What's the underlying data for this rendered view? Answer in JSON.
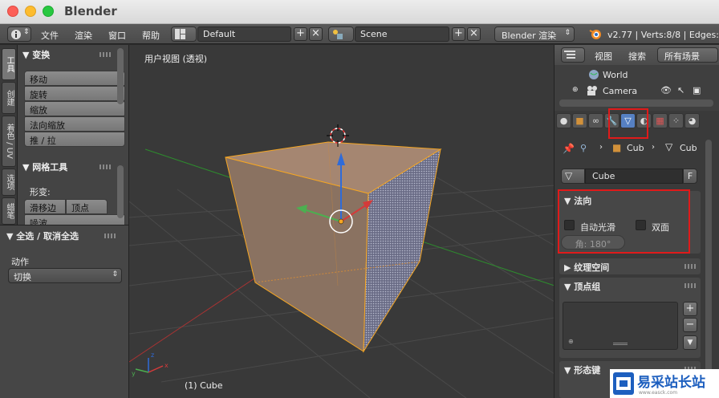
{
  "window": {
    "title": "Blender"
  },
  "header": {
    "menus": [
      "文件",
      "渲染",
      "窗口",
      "帮助"
    ],
    "screen_layout": "Default",
    "scene": "Scene",
    "render_engine": "Blender 渲染",
    "status": "v2.77 | Verts:8/8 | Edges:1"
  },
  "left_tabs": [
    "工具",
    "创建",
    "着色 / UV",
    "选项",
    "蜡笔"
  ],
  "tools": {
    "transform_header": "▼ 变换",
    "transform_buttons": [
      "移动",
      "旋转",
      "缩放",
      "法向缩放",
      "推 / 拉"
    ],
    "mesh_tools_header": "▼ 网格工具",
    "deform_label": "形变:",
    "slide_edge": "滑移边",
    "vertex": "顶点",
    "smooth_partial": "噪波"
  },
  "operator": {
    "header": "▼ 全选 / 取消全选",
    "action_label": "动作",
    "action_value": "切换"
  },
  "viewport": {
    "title": "用户视图 (透视)",
    "object_name": "(1) Cube"
  },
  "outliner": {
    "view_menu": "视图",
    "search_menu": "搜索",
    "scope": "所有场景",
    "items": [
      "World",
      "Camera"
    ]
  },
  "properties": {
    "breadcrumb_object": "Cub",
    "breadcrumb_data": "Cub",
    "mesh_name": "Cube",
    "fake_user": "F",
    "normals_header": "▼ 法向",
    "auto_smooth": "自动光滑",
    "double_sided": "双面",
    "angle": "角: 180°",
    "texture_space_header": "▶ 纹理空间",
    "vertex_groups_header": "▼ 顶点组",
    "shape_keys_header": "▼ 形态键"
  },
  "watermark": {
    "name": "易采站长站",
    "url": "www.easck.com"
  },
  "colors": {
    "selection": "#f5a623",
    "highlight_box": "#e01a1a",
    "x_axis": "#d43a3a",
    "y_axis": "#4caf50",
    "z_axis": "#2f6bd8"
  }
}
